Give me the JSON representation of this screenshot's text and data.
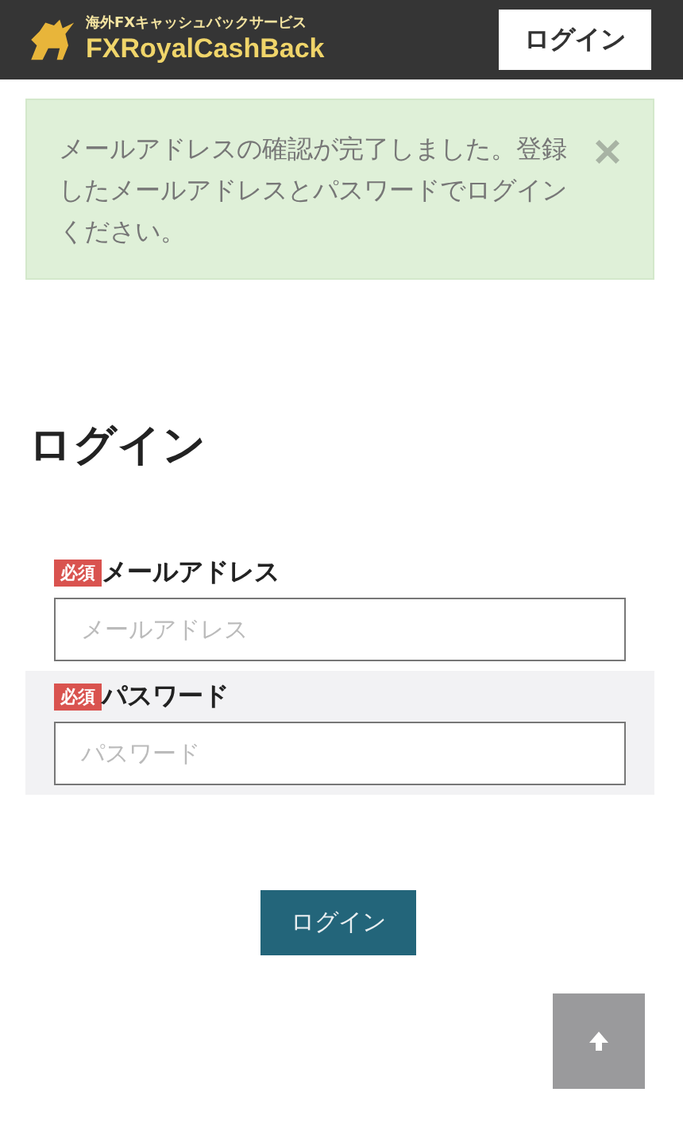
{
  "header": {
    "logo_subtitle": "海外FXキャッシュバックサービス",
    "logo_title": "FXRoyalCashBack",
    "login_button": "ログイン"
  },
  "alert": {
    "message": "メールアドレスの確認が完了しました。登録したメールアドレスとパスワードでログインください。"
  },
  "page_title": "ログイン",
  "fields": [
    {
      "badge": "必須",
      "label": "メールアドレス",
      "placeholder": "メールアドレス",
      "shaded": false
    },
    {
      "badge": "必須",
      "label": "パスワード",
      "placeholder": "パスワード",
      "shaded": true
    }
  ],
  "submit_button": "ログイン"
}
